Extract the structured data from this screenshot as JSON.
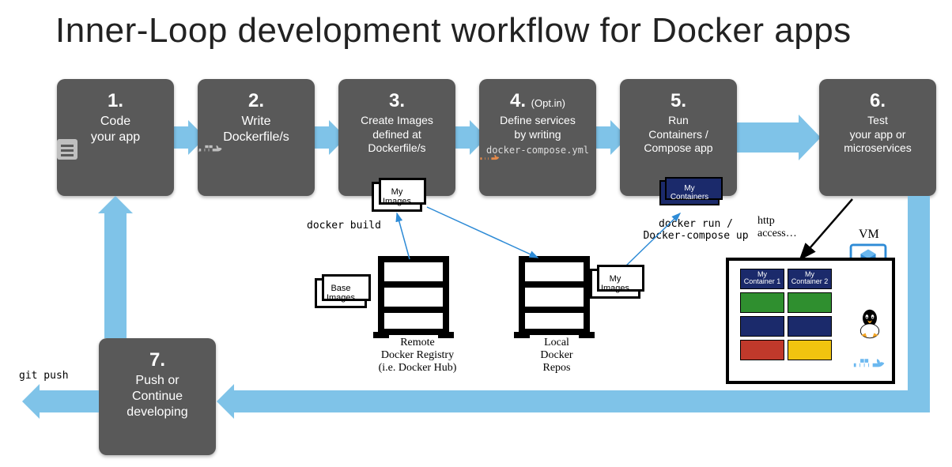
{
  "title": "Inner-Loop development workflow for Docker apps",
  "steps": {
    "s1": {
      "num": "1.",
      "l1": "Code",
      "l2": "your app"
    },
    "s2": {
      "num": "2.",
      "l1": "Write",
      "l2": "Dockerfile/s"
    },
    "s3": {
      "num": "3.",
      "l1": "Create Images",
      "l2": "defined at",
      "l3": "Dockerfile/s"
    },
    "s4": {
      "num": "4.",
      "opt": "(Opt.in)",
      "l1": "Define services",
      "l2": "by writing",
      "mono": "docker-compose.yml"
    },
    "s5": {
      "num": "5.",
      "l1": "Run",
      "l2": "Containers /",
      "l3": "Compose app"
    },
    "s6": {
      "num": "6.",
      "l1": "Test",
      "l2": "your app or",
      "l3": "microservices"
    },
    "s7": {
      "num": "7.",
      "l1": "Push or",
      "l2": "Continue",
      "l3": "developing"
    }
  },
  "labels": {
    "docker_build": "docker build",
    "my_images": "My\nImages",
    "base_images": "Base\nImages",
    "remote_registry_l1": "Remote",
    "remote_registry_l2": "Docker Registry",
    "remote_registry_l3": "(i.e. Docker Hub)",
    "local_repos_l1": "Local",
    "local_repos_l2": "Docker",
    "local_repos_l3": "Repos",
    "my_containers": "My\nContainers",
    "docker_run_l1": "docker run /",
    "docker_run_l2": "Docker-compose up",
    "http_l1": "http",
    "http_l2": "access…",
    "vm": "VM",
    "vm_c1": "My\nContainer 1",
    "vm_c2": "My\nContainer 2",
    "git_push": "git push"
  },
  "colors": {
    "step_bg": "#595959",
    "arrow": "#7fc3e8",
    "container": "#1b2a6b",
    "green": "#2f8f2f",
    "navy": "#1b2a6b",
    "red": "#c0392b",
    "yellow": "#f1c40f",
    "azure": "#2e8bd6"
  }
}
